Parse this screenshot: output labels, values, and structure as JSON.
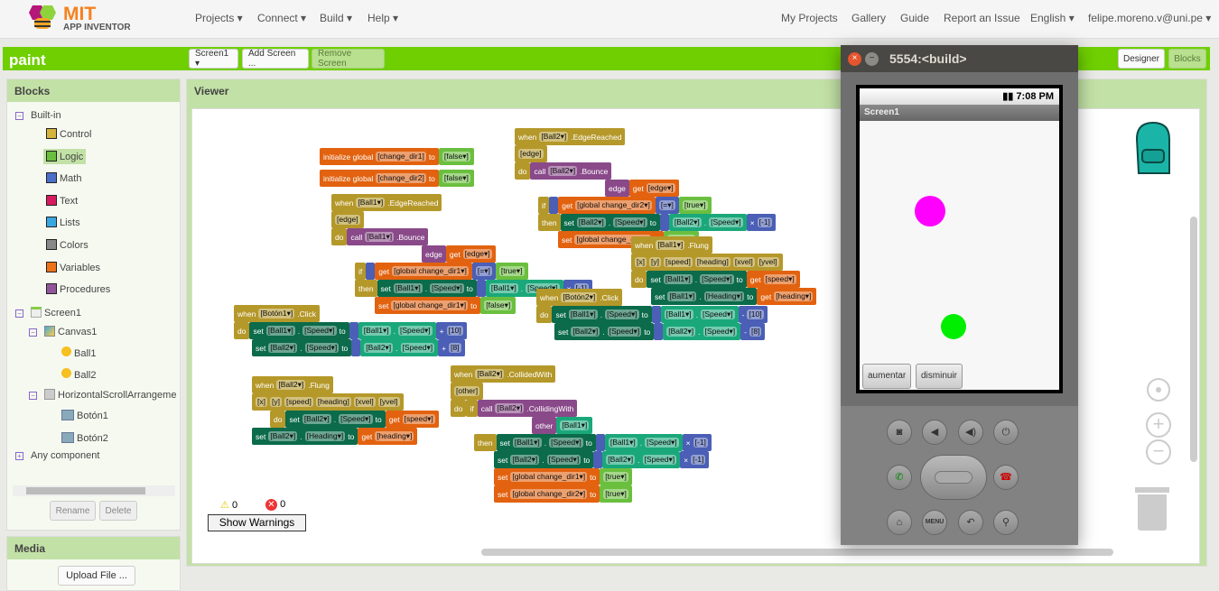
{
  "header": {
    "logo_line1": "MIT",
    "logo_line2": "APP INVENTOR",
    "nav_left": [
      "Projects ▾",
      "Connect ▾",
      "Build ▾",
      "Help ▾"
    ],
    "nav_right": [
      "My Projects",
      "Gallery",
      "Guide",
      "Report an Issue",
      "English ▾",
      "felipe.moreno.v@uni.pe ▾"
    ]
  },
  "project": {
    "name": "paint",
    "screen_select": "Screen1 ▾",
    "add_screen": "Add Screen ...",
    "remove_screen": "Remove Screen",
    "designer": "Designer",
    "blocks": "Blocks"
  },
  "blocks_panel": {
    "title": "Blocks",
    "builtin": "Built-in",
    "categories": [
      {
        "label": "Control",
        "color": "#d4b43a"
      },
      {
        "label": "Logic",
        "color": "#6bbf3f"
      },
      {
        "label": "Math",
        "color": "#4a6fc8"
      },
      {
        "label": "Text",
        "color": "#d81b60"
      },
      {
        "label": "Lists",
        "color": "#3aa8e0"
      },
      {
        "label": "Colors",
        "color": "#888888"
      },
      {
        "label": "Variables",
        "color": "#ee7318"
      },
      {
        "label": "Procedures",
        "color": "#91569a"
      }
    ],
    "selected": "Logic",
    "components": [
      "Screen1",
      "Canvas1",
      "Ball1",
      "Ball2",
      "HorizontalScrollArrangeme",
      "Botón1",
      "Botón2"
    ],
    "any_component": "Any component",
    "rename": "Rename",
    "delete": "Delete"
  },
  "media": {
    "title": "Media",
    "upload": "Upload File ..."
  },
  "viewer": {
    "title": "Viewer",
    "warnings_count": "0",
    "errors_count": "0",
    "show_warnings": "Show Warnings"
  },
  "workspace_blocks": [
    {
      "lines": [
        [
          [
            "var",
            "initialize global",
            "[change_dir1]",
            "to"
          ],
          [
            "logic",
            "[false▾]"
          ]
        ]
      ]
    },
    {
      "lines": [
        [
          [
            "var",
            "initialize global",
            "[change_dir2]",
            "to"
          ],
          [
            "logic",
            "[false▾]"
          ]
        ]
      ]
    },
    {
      "lines": [
        [
          [
            "event",
            "when",
            "[Ball1▾]",
            ".EdgeReached"
          ]
        ],
        [
          [
            "event",
            "[edge]"
          ]
        ],
        [
          [
            "event",
            "do"
          ],
          [
            "proc",
            "call",
            "[Ball1▾]",
            ".Bounce"
          ]
        ],
        [
          [
            "proc",
            "edge"
          ],
          [
            "var",
            "get",
            "[edge▾]"
          ]
        ],
        [
          [
            "event",
            "if"
          ],
          [
            "math"
          ],
          [
            "var",
            "get",
            "[global change_dir1▾]"
          ],
          [
            "math",
            "[=▾]"
          ],
          [
            "logic",
            "[true▾]"
          ]
        ],
        [
          [
            "event",
            "then"
          ],
          [
            "comp",
            "set",
            "[Ball1▾]",
            ".",
            "[Speed▾]",
            "to"
          ],
          [
            "math"
          ],
          [
            "getc",
            "[Ball1▾]",
            ".",
            "[Speed▾]"
          ],
          [
            "math",
            "×",
            "[-1]"
          ]
        ],
        [
          [
            "var",
            "set",
            "[global change_dir1▾]",
            "to"
          ],
          [
            "logic",
            "[false▾]"
          ]
        ]
      ]
    },
    {
      "lines": [
        [
          [
            "event",
            "when",
            "[Ball2▾]",
            ".EdgeReached"
          ]
        ],
        [
          [
            "event",
            "[edge]"
          ]
        ],
        [
          [
            "event",
            "do"
          ],
          [
            "proc",
            "call",
            "[Ball2▾]",
            ".Bounce"
          ]
        ],
        [
          [
            "proc",
            "edge"
          ],
          [
            "var",
            "get",
            "[edge▾]"
          ]
        ],
        [
          [
            "event",
            "if"
          ],
          [
            "math"
          ],
          [
            "var",
            "get",
            "[global change_dir2▾]"
          ],
          [
            "math",
            "[=▾]"
          ],
          [
            "logic",
            "[true▾]"
          ]
        ],
        [
          [
            "event",
            "then"
          ],
          [
            "comp",
            "set",
            "[Ball2▾]",
            ".",
            "[Speed▾]",
            "to"
          ],
          [
            "math"
          ],
          [
            "getc",
            "[Ball2▾]",
            ".",
            "[Speed▾]"
          ],
          [
            "math",
            "×",
            "[-1]"
          ]
        ],
        [
          [
            "var",
            "set",
            "[global change_dir2▾]",
            "to"
          ],
          [
            "logic",
            "[false▾]"
          ]
        ]
      ]
    },
    {
      "lines": [
        [
          [
            "event",
            "when",
            "[Ball1▾]",
            ".Flung"
          ]
        ],
        [
          [
            "event",
            "[x]",
            "[y]",
            "[speed]",
            "[heading]",
            "[xvel]",
            "[yvel]"
          ]
        ],
        [
          [
            "event",
            "do"
          ],
          [
            "comp",
            "set",
            "[Ball1▾]",
            ".",
            "[Speed▾]",
            "to"
          ],
          [
            "var",
            "get",
            "[speed▾]"
          ]
        ],
        [
          [
            "comp",
            "set",
            "[Ball1▾]",
            ".",
            "[Heading▾]",
            "to"
          ],
          [
            "var",
            "get",
            "[heading▾]"
          ]
        ]
      ]
    },
    {
      "lines": [
        [
          [
            "event",
            "when",
            "[Botón2▾]",
            ".Click"
          ]
        ],
        [
          [
            "event",
            "do"
          ],
          [
            "comp",
            "set",
            "[Ball1▾]",
            ".",
            "[Speed▾]",
            "to"
          ],
          [
            "math"
          ],
          [
            "getc",
            "[Ball1▾]",
            ".",
            "[Speed▾]"
          ],
          [
            "math",
            "-",
            "[10]"
          ]
        ],
        [
          [
            "comp",
            "set",
            "[Ball2▾]",
            ".",
            "[Speed▾]",
            "to"
          ],
          [
            "math"
          ],
          [
            "getc",
            "[Ball2▾]",
            ".",
            "[Speed▾]"
          ],
          [
            "math",
            "-",
            "[8]"
          ]
        ]
      ]
    },
    {
      "lines": [
        [
          [
            "event",
            "when",
            "[Botón1▾]",
            ".Click"
          ]
        ],
        [
          [
            "event",
            "do"
          ],
          [
            "comp",
            "set",
            "[Ball1▾]",
            ".",
            "[Speed▾]",
            "to"
          ],
          [
            "math"
          ],
          [
            "getc",
            "[Ball1▾]",
            ".",
            "[Speed▾]"
          ],
          [
            "math",
            "+",
            "[10]"
          ]
        ],
        [
          [
            "comp",
            "set",
            "[Ball2▾]",
            ".",
            "[Speed▾]",
            "to"
          ],
          [
            "math"
          ],
          [
            "getc",
            "[Ball2▾]",
            ".",
            "[Speed▾]"
          ],
          [
            "math",
            "+",
            "[8]"
          ]
        ]
      ]
    },
    {
      "lines": [
        [
          [
            "event",
            "when",
            "[Ball2▾]",
            ".Flung"
          ]
        ],
        [
          [
            "event",
            "[x]",
            "[y]",
            "[speed]",
            "[heading]",
            "[xvel]",
            "[yvel]"
          ]
        ],
        [
          [
            "event",
            "do"
          ],
          [
            "comp",
            "set",
            "[Ball2▾]",
            ".",
            "[Speed▾]",
            "to"
          ],
          [
            "var",
            "get",
            "[speed▾]"
          ]
        ],
        [
          [
            "comp",
            "set",
            "[Ball2▾]",
            ".",
            "[Heading▾]",
            "to"
          ],
          [
            "var",
            "get",
            "[heading▾]"
          ]
        ]
      ]
    },
    {
      "lines": [
        [
          [
            "event",
            "when",
            "[Ball2▾]",
            ".CollidedWith"
          ]
        ],
        [
          [
            "event",
            "[other]"
          ]
        ],
        [
          [
            "event",
            "do"
          ],
          [
            "event",
            "if"
          ],
          [
            "proc",
            "call",
            "[Ball2▾]",
            ".CollidingWith"
          ]
        ],
        [
          [
            "proc",
            "other"
          ],
          [
            "getc",
            "[Ball1▾]"
          ]
        ],
        [
          [
            "event",
            "then"
          ],
          [
            "comp",
            "set",
            "[Ball1▾]",
            ".",
            "[Speed▾]",
            "to"
          ],
          [
            "math"
          ],
          [
            "getc",
            "[Ball1▾]",
            ".",
            "[Speed▾]"
          ],
          [
            "math",
            "×",
            "[-1]"
          ]
        ],
        [
          [
            "comp",
            "set",
            "[Ball2▾]",
            ".",
            "[Speed▾]",
            "to"
          ],
          [
            "math"
          ],
          [
            "getc",
            "[Ball2▾]",
            ".",
            "[Speed▾]"
          ],
          [
            "math",
            "×",
            "[-1]"
          ]
        ],
        [
          [
            "var",
            "set",
            "[global change_dir1▾]",
            "to"
          ],
          [
            "logic",
            "[true▾]"
          ]
        ],
        [
          [
            "var",
            "set",
            "[global change_dir2▾]",
            "to"
          ],
          [
            "logic",
            "[true▾]"
          ]
        ]
      ]
    }
  ],
  "emulator": {
    "title": "5554:<build>",
    "time": "7:08 PM",
    "app_title": "Screen1",
    "button1": "aumentar",
    "button2": "disminuir",
    "ball1_color": "#ff00ff",
    "ball2_color": "#00ee00",
    "menu_key": "MENU"
  }
}
